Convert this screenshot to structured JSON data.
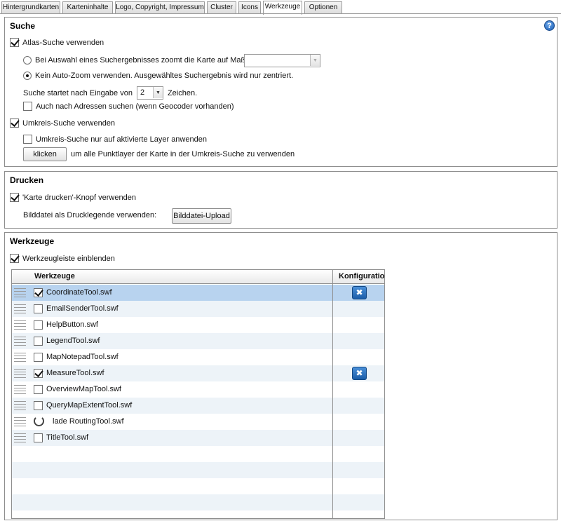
{
  "tabs": [
    {
      "label": "Hintergrundkarten",
      "active": false
    },
    {
      "label": "Karteninhalte",
      "active": false
    },
    {
      "label": "Logo, Copyright, Impressum",
      "active": false
    },
    {
      "label": "Cluster",
      "active": false
    },
    {
      "label": "Icons",
      "active": false
    },
    {
      "label": "Werkzeuge",
      "active": true
    },
    {
      "label": "Optionen",
      "active": false
    }
  ],
  "suche": {
    "title": "Suche",
    "help_icon": "question-icon",
    "atlas_label": "Atlas-Suche verwenden",
    "atlas_checked": true,
    "radio_zoom_label": "Bei Auswahl eines  Suchergebnisses zoomt die Karte auf Maßstab:",
    "radio_zoom_selected": false,
    "scale_value": "",
    "radio_center_label": "Kein Auto-Zoom verwenden. Ausgewähltes Suchergebnis wird nur zentriert.",
    "radio_center_selected": true,
    "start_prefix": "Suche startet nach Eingabe von",
    "start_value": "2",
    "start_suffix": "Zeichen.",
    "address_label": "Auch nach Adressen suchen (wenn Geocoder vorhanden)",
    "address_checked": false,
    "umkreis_label": "Umkreis-Suche verwenden",
    "umkreis_checked": true,
    "umkreis_active_label": "Umkreis-Suche nur auf aktivierte Layer anwenden",
    "umkreis_active_checked": false,
    "klicken_label": "klicken",
    "klicken_desc": "um alle Punktlayer der Karte in der Umkreis-Suche zu verwenden"
  },
  "drucken": {
    "title": "Drucken",
    "print_label": "'Karte drucken'-Knopf verwenden",
    "print_checked": true,
    "image_label": "Bilddatei als Drucklegende verwenden:",
    "upload_label": "Bilddatei-Upload"
  },
  "werkzeuge": {
    "title": "Werkzeuge",
    "toolbar_label": "Werkzeugleiste einblenden",
    "toolbar_checked": true,
    "col_tools": "Werkzeuge",
    "col_config": "Konfiguration",
    "tools": [
      {
        "name": "CoordinateTool.swf",
        "checked": true,
        "config": true,
        "selected": true,
        "loading": false
      },
      {
        "name": "EmailSenderTool.swf",
        "checked": false,
        "config": false,
        "selected": false,
        "loading": false
      },
      {
        "name": "HelpButton.swf",
        "checked": false,
        "config": false,
        "selected": false,
        "loading": false
      },
      {
        "name": "LegendTool.swf",
        "checked": false,
        "config": false,
        "selected": false,
        "loading": false
      },
      {
        "name": "MapNotepadTool.swf",
        "checked": false,
        "config": false,
        "selected": false,
        "loading": false
      },
      {
        "name": "MeasureTool.swf",
        "checked": true,
        "config": true,
        "selected": false,
        "loading": false
      },
      {
        "name": "OverviewMapTool.swf",
        "checked": false,
        "config": false,
        "selected": false,
        "loading": false
      },
      {
        "name": "QueryMapExtentTool.swf",
        "checked": false,
        "config": false,
        "selected": false,
        "loading": false
      },
      {
        "name": "lade RoutingTool.swf",
        "checked": false,
        "config": false,
        "selected": false,
        "loading": true
      },
      {
        "name": "TitleTool.swf",
        "checked": false,
        "config": false,
        "selected": false,
        "loading": false
      }
    ],
    "empty_rows": 5,
    "config_icon": "wrench-screwdriver-icon"
  }
}
